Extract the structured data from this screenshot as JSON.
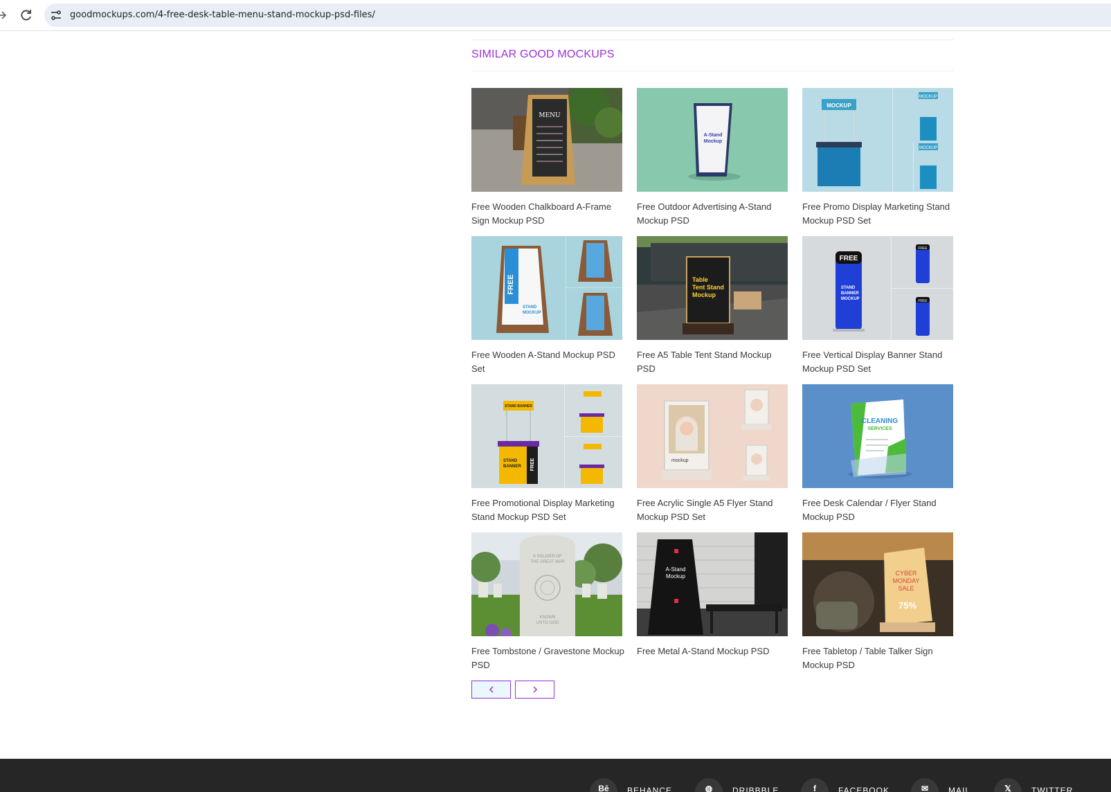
{
  "browser": {
    "url": "goodmockups.com/4-free-desk-table-menu-stand-mockup-psd-files/"
  },
  "section": {
    "title": "SIMILAR GOOD MOCKUPS"
  },
  "cards": [
    {
      "title": "Free Wooden Chalkboard A-Frame Sign Mockup PSD",
      "texts": [
        "MENU"
      ]
    },
    {
      "title": "Free Outdoor Advertising A-Stand Mockup PSD",
      "texts": [
        "A-Stand",
        "Mockup"
      ]
    },
    {
      "title": "Free Promo Display Marketing Stand Mockup PSD Set",
      "texts": [
        "MOCKUP",
        "MOCKUP",
        "MOCKUP"
      ]
    },
    {
      "title": "Free Wooden A-Stand Mockup PSD Set",
      "texts": [
        "FREE",
        "STAND",
        "MOCKUP"
      ]
    },
    {
      "title": "Free A5 Table Tent Stand Mockup PSD",
      "texts": [
        "Table",
        "Tent Stand",
        "Mockup"
      ]
    },
    {
      "title": "Free Vertical Display Banner Stand Mockup PSD Set",
      "texts": [
        "FREE",
        "STAND",
        "BANNER",
        "MOCKUP",
        "FREE",
        "FREE"
      ]
    },
    {
      "title": "Free Promotional Display Marketing Stand Mockup PSD Set",
      "texts": [
        "STAND BANNER",
        "STAND",
        "BANNER",
        "FREE"
      ]
    },
    {
      "title": "Free Acrylic Single A5 Flyer Stand Mockup PSD Set",
      "texts": [
        "mockup"
      ]
    },
    {
      "title": "Free Desk Calendar / Flyer Stand Mockup PSD",
      "texts": [
        "CLEANING",
        "SERVICES"
      ]
    },
    {
      "title": "Free Tombstone / Gravestone Mockup PSD",
      "texts": [
        "A SOLDIER OF",
        "THE GREAT WAR",
        "KNOWN",
        "UNTO GOD"
      ]
    },
    {
      "title": "Free Metal A-Stand Mockup PSD",
      "texts": [
        "A-Stand",
        "Mockup"
      ]
    },
    {
      "title": "Free Tabletop / Table Talker Sign Mockup PSD",
      "texts": [
        "CYBER",
        "MONDAY",
        "SALE",
        "75%"
      ]
    }
  ],
  "pager": {
    "prev_icon": "chevron-left-icon",
    "next_icon": "chevron-right-icon"
  },
  "footer": {
    "social": [
      {
        "label": "BEHANCE",
        "icon_text": "Bē",
        "icon": "behance-icon"
      },
      {
        "label": "DRIBBBLE",
        "icon_text": "◍",
        "icon": "dribbble-icon"
      },
      {
        "label": "FACEBOOK",
        "icon_text": "f",
        "icon": "facebook-icon"
      },
      {
        "label": "MAIL",
        "icon_text": "✉",
        "icon": "mail-icon"
      },
      {
        "label": "TWITTER",
        "icon_text": "𝕏",
        "icon": "twitter-icon"
      }
    ]
  },
  "colors": {
    "accent": "#9b30d9",
    "footer_bg": "#262626",
    "pager_bg": "#eaf7fc"
  }
}
